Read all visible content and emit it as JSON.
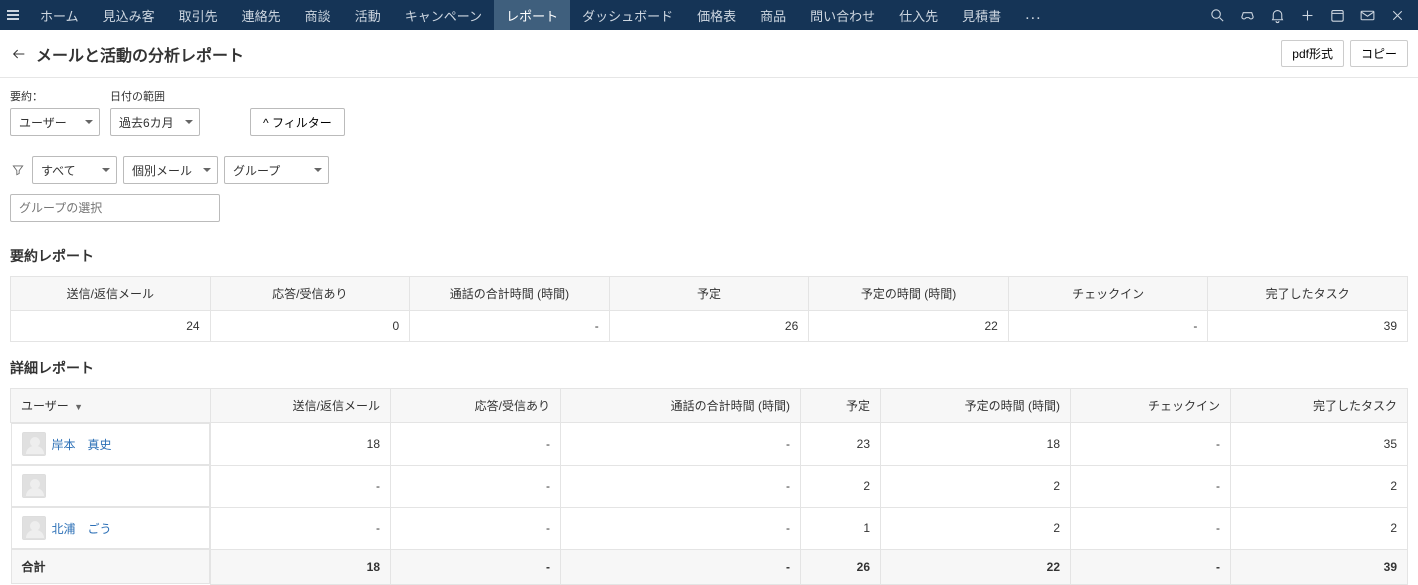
{
  "nav": {
    "items": [
      "ホーム",
      "見込み客",
      "取引先",
      "連絡先",
      "商談",
      "活動",
      "キャンペーン",
      "レポート",
      "ダッシュボード",
      "価格表",
      "商品",
      "問い合わせ",
      "仕入先",
      "見積書"
    ],
    "active_index": 7,
    "more": "..."
  },
  "header": {
    "title": "メールと活動の分析レポート",
    "pdf": "pdf形式",
    "copy": "コピー"
  },
  "filters": {
    "summary_label": "要約：",
    "date_label": "日付の範囲",
    "summary_value": "ユーザー",
    "date_value": "過去6カ月",
    "filter_btn": "^ フィルター",
    "all": "すべて",
    "mail_type": "個別メール",
    "group_label": "グループ",
    "group_placeholder": "グループの選択"
  },
  "summary": {
    "title": "要約レポート",
    "headers": [
      "送信/返信メール",
      "応答/受信あり",
      "通話の合計時間 (時間)",
      "予定",
      "予定の時間 (時間)",
      "チェックイン",
      "完了したタスク"
    ],
    "row": [
      "24",
      "0",
      "-",
      "26",
      "22",
      "-",
      "39"
    ]
  },
  "detail": {
    "title": "詳細レポート",
    "user_header": "ユーザー",
    "sort_indicator": "▼",
    "headers": [
      "送信/返信メール",
      "応答/受信あり",
      "通話の合計時間 (時間)",
      "予定",
      "予定の時間 (時間)",
      "チェックイン",
      "完了したタスク"
    ],
    "rows": [
      {
        "user": "岸本　真史",
        "has_link": true,
        "values": [
          "18",
          "-",
          "-",
          "23",
          "18",
          "-",
          "35"
        ]
      },
      {
        "user": "",
        "has_link": false,
        "values": [
          "-",
          "-",
          "-",
          "2",
          "2",
          "-",
          "2"
        ]
      },
      {
        "user": "北浦　ごう",
        "has_link": true,
        "values": [
          "-",
          "-",
          "-",
          "1",
          "2",
          "-",
          "2"
        ]
      }
    ],
    "total_label": "合計",
    "total_values": [
      "18",
      "-",
      "-",
      "26",
      "22",
      "-",
      "39"
    ]
  }
}
